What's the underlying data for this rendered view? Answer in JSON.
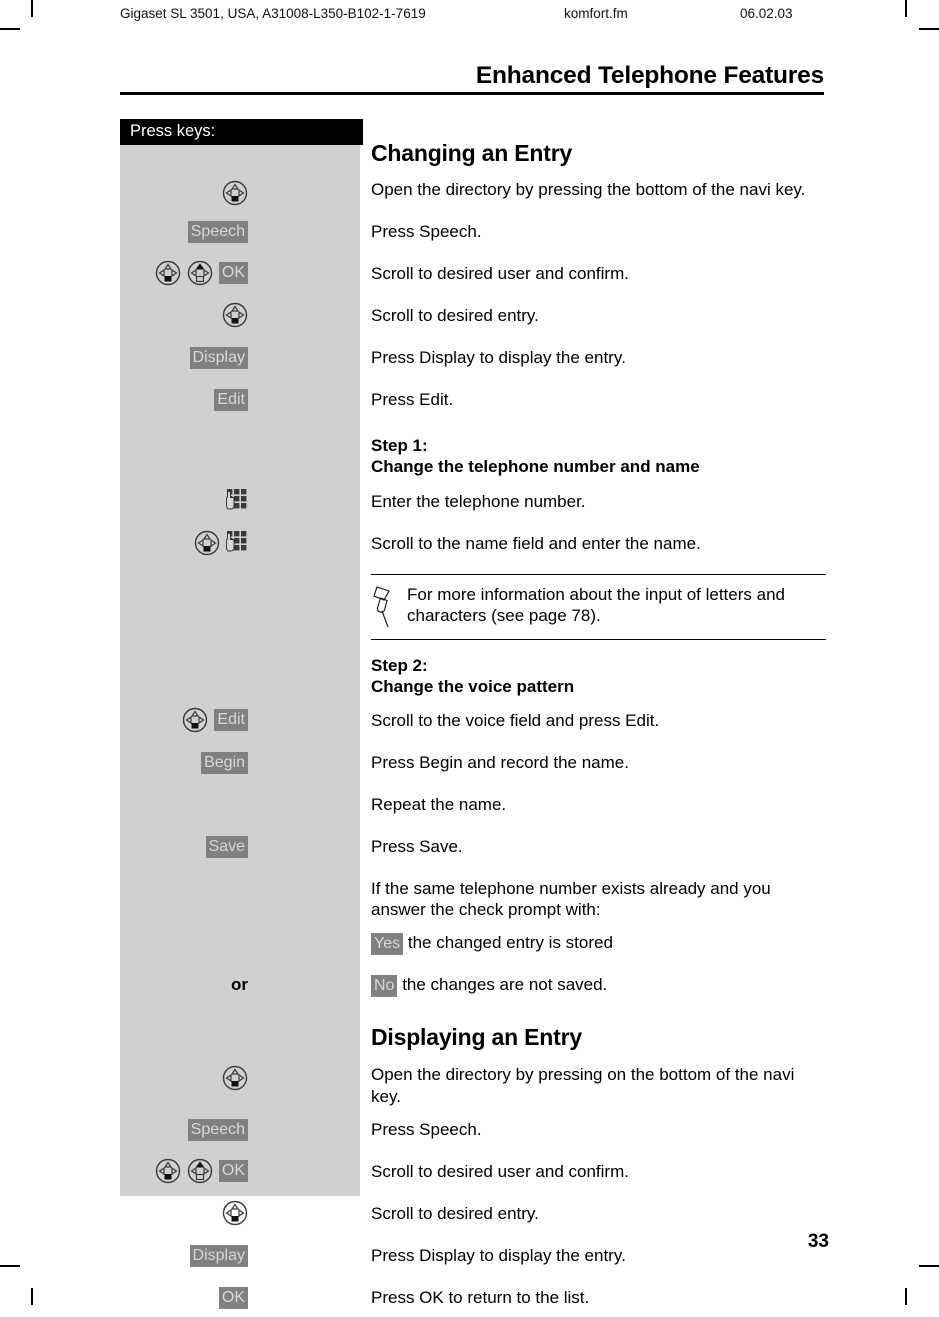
{
  "meta": {
    "document": "Gigaset SL 3501, USA, A31008-L350-B102-1-7619",
    "file": "komfort.fm",
    "date": "06.02.03"
  },
  "chapter_title": "Enhanced Telephone Features",
  "page_number": "33",
  "key_panel": {
    "header": "Press keys:"
  },
  "sections": [
    {
      "heading": "Changing an Entry",
      "rows": [
        {
          "keys": [
            "navi-down-icon"
          ],
          "text": "Open the directory by pressing the bottom of the navi key."
        },
        {
          "keys": [
            "softkey:Speech"
          ],
          "text": "Press Speech."
        },
        {
          "keys": [
            "navi-down-icon",
            "navi-up-icon",
            "softkey:OK"
          ],
          "text": "Scroll to desired user and confirm."
        },
        {
          "keys": [
            "navi-down-icon"
          ],
          "text": "Scroll to desired entry."
        },
        {
          "keys": [
            "softkey:Display"
          ],
          "text": "Press Display to display the entry."
        },
        {
          "keys": [
            "softkey:Edit"
          ],
          "text": "Press Edit."
        }
      ]
    }
  ],
  "step1": {
    "label": "Step 1:",
    "title": "Change the telephone number and name",
    "rows": [
      {
        "keys": [
          "keypad-icon"
        ],
        "text": "Enter the telephone number."
      },
      {
        "keys": [
          "navi-down-icon",
          "keypad-icon"
        ],
        "text": "Scroll to the name field and enter the name."
      }
    ]
  },
  "note": {
    "icon": "pushpin-icon",
    "text": "For more information about the input of letters and characters (see page 78)."
  },
  "step2": {
    "label": "Step 2:",
    "title": "Change the voice pattern",
    "rows": [
      {
        "keys": [
          "navi-down-icon",
          "softkey:Edit"
        ],
        "text": "Scroll to the voice field and press Edit."
      },
      {
        "keys": [
          "softkey:Begin"
        ],
        "text": "Press Begin and record the name."
      },
      {
        "keys": [],
        "text": "Repeat the name."
      },
      {
        "keys": [
          "softkey:Save"
        ],
        "text": "Press Save."
      },
      {
        "keys": [],
        "text": "If the same telephone number exists already and you answer the check prompt with:"
      }
    ],
    "yes_key": "Yes",
    "yes_text": "the changed entry is stored",
    "or_label": "or",
    "no_key": "No",
    "no_text": "the changes are not saved."
  },
  "section2": {
    "heading": "Displaying an Entry",
    "rows": [
      {
        "keys": [
          "navi-down-icon"
        ],
        "text": "Open the directory by pressing on the bottom of the navi key."
      },
      {
        "keys": [
          "softkey:Speech"
        ],
        "text": "Press Speech."
      },
      {
        "keys": [
          "navi-down-icon",
          "navi-up-icon",
          "softkey:OK"
        ],
        "text": "Scroll to desired user and confirm."
      },
      {
        "keys": [
          "navi-down-icon"
        ],
        "text": "Scroll to desired entry."
      },
      {
        "keys": [
          "softkey:Display"
        ],
        "text": "Press Display to display the entry."
      },
      {
        "keys": [
          "softkey:OK"
        ],
        "text": "Press OK to return to the list."
      }
    ]
  },
  "colors": {
    "panel_bg": "#d0d0d0",
    "panel_header_bg": "#000000",
    "softkey_bg": "#808080",
    "softkey_text": "#d8d8d8"
  }
}
